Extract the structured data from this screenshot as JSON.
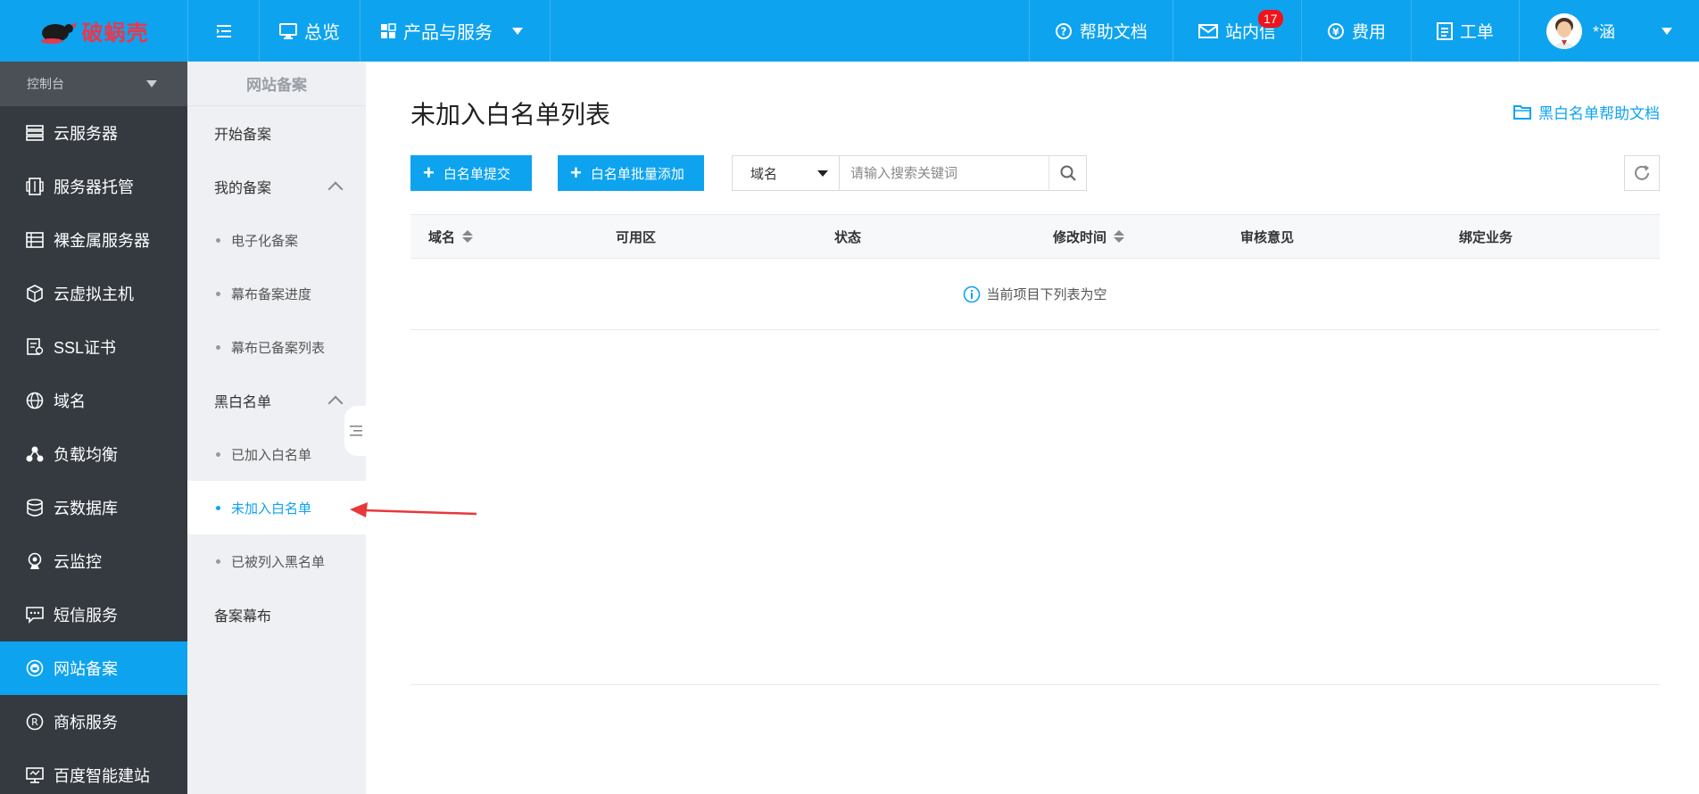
{
  "brand": {
    "name": "破蜗壳",
    "accent": "#0ea3ef",
    "logo_color": "#e8384f"
  },
  "topnav": {
    "overview": "总览",
    "products": "产品与服务",
    "help": "帮助文档",
    "messages": "站内信",
    "messages_badge": "17",
    "fees": "费用",
    "tickets": "工单",
    "user": "*涵"
  },
  "sidebar": {
    "console": "控制台",
    "items": [
      {
        "label": "云服务器",
        "icon": "server-icon"
      },
      {
        "label": "服务器托管",
        "icon": "hosting-icon"
      },
      {
        "label": "裸金属服务器",
        "icon": "bare-metal-icon"
      },
      {
        "label": "云虚拟主机",
        "icon": "cube-icon"
      },
      {
        "label": "SSL证书",
        "icon": "certificate-icon"
      },
      {
        "label": "域名",
        "icon": "globe-icon"
      },
      {
        "label": "负载均衡",
        "icon": "load-balance-icon"
      },
      {
        "label": "云数据库",
        "icon": "database-icon"
      },
      {
        "label": "云监控",
        "icon": "monitor-icon"
      },
      {
        "label": "短信服务",
        "icon": "sms-icon"
      },
      {
        "label": "网站备案",
        "icon": "record-icon"
      },
      {
        "label": "商标服务",
        "icon": "trademark-icon"
      },
      {
        "label": "百度智能建站",
        "icon": "site-builder-icon"
      }
    ]
  },
  "subnav": {
    "title": "网站备案",
    "start": "开始备案",
    "my_records": "我的备案",
    "e_record": "电子化备案",
    "progress": "幕布备案进度",
    "record_list": "幕布已备案列表",
    "blackwhite": "黑白名单",
    "whitelisted": "已加入白名单",
    "not_whitelisted": "未加入白名单",
    "blacklisted": "已被列入黑名单",
    "curtain": "备案幕布"
  },
  "main": {
    "title": "未加入白名单列表",
    "help_link": "黑白名单帮助文档",
    "submit_btn": "白名单提交",
    "batch_btn": "白名单批量添加",
    "search_field": "域名",
    "search_placeholder": "请输入搜索关键词",
    "columns": [
      "域名",
      "可用区",
      "状态",
      "修改时间",
      "审核意见",
      "绑定业务"
    ],
    "empty": "当前项目下列表为空"
  }
}
